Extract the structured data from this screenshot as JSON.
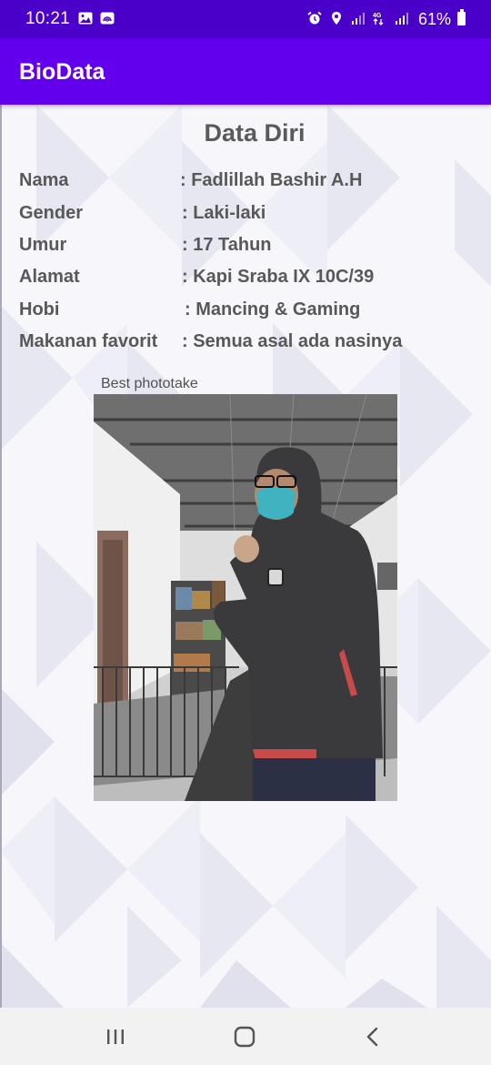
{
  "status_bar": {
    "time": "10:21",
    "battery": "61%",
    "network": "4G",
    "icons": [
      "gallery-icon",
      "cast-icon",
      "alarm-icon",
      "location-icon",
      "signal-icon",
      "signal-4g-icon",
      "signal-icon",
      "battery-icon"
    ]
  },
  "app_bar": {
    "title": "BioData",
    "color": "#6200ee",
    "status_color": "#4a00c8"
  },
  "content": {
    "section_title": "Data Diri",
    "rows": [
      {
        "label": "Nama",
        "value": ": Fadlillah Bashir A.H"
      },
      {
        "label": "Gender",
        "value": ": Laki-laki"
      },
      {
        "label": "Umur",
        "value": ": 17 Tahun"
      },
      {
        "label": "Alamat",
        "value": ": Kapi Sraba IX 10C/39"
      },
      {
        "label": "Hobi",
        "value": ": Mancing & Gaming"
      },
      {
        "label": "Makanan favorit",
        "value": ": Semua asal ada nasinya"
      }
    ],
    "photo_caption": "Best phototake",
    "text_color": "#585858"
  },
  "nav_bar": {
    "buttons": [
      "recents-icon",
      "home-icon",
      "back-icon"
    ]
  }
}
